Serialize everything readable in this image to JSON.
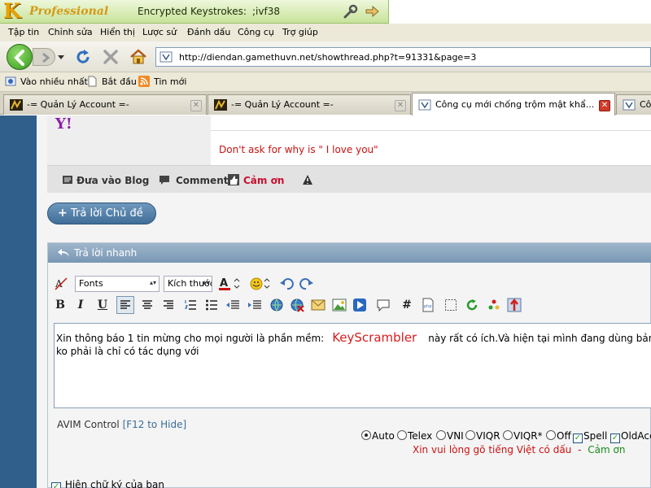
{
  "keyscrambler": {
    "logo_letter": "K",
    "edition": "Professional",
    "status_label": "Encrypted Keystrokes:",
    "keystrokes": ";ivf38"
  },
  "menu": [
    "Tập tin",
    "Chỉnh sửa",
    "Hiển thị",
    "Lược sử",
    "Đánh dấu",
    "Công cụ",
    "Trợ giúp"
  ],
  "navigation": {
    "url": "http://diendan.gamethuvn.net/showthread.php?t=91331&page=3"
  },
  "bookmarks": [
    "Vào nhiều nhất",
    "Bắt đầu",
    "Tin mới"
  ],
  "tabs": [
    {
      "label": "-= Quản Lý Account =-",
      "active": false
    },
    {
      "label": "-= Quản Lý Account =-",
      "active": false
    },
    {
      "label": "Công cụ mới chống trộm mật khẩ...",
      "active": true
    },
    {
      "label": "Côn",
      "active": false
    }
  ],
  "post": {
    "signature": "Don't ask for why is \" I love you\"",
    "actions": {
      "blog": "Đưa vào Blog",
      "comment": "Comment",
      "thanks": "Cảm ơn"
    }
  },
  "reply_button": "Trả lời Chủ đề",
  "quick_reply": {
    "title": "Trả lời nhanh",
    "font_select": "Fonts",
    "size_select": "Kích thước",
    "editor_before": "Xin thông báo 1 tin mừng cho mọi người là phần mềm:",
    "editor_highlight": "KeyScrambler",
    "editor_after": "này rất có ích.Và hiện tại mình đang dùng bản full c",
    "editor_line2": "ko phải là chỉ có tác dụng với",
    "avim_label": "AVIM Control",
    "avim_hide": "[F12 to Hide]",
    "avim_options": [
      "Auto",
      "Telex",
      "VNI",
      "VIQR",
      "VIQR*",
      "Off",
      "Spell",
      "OldAcc"
    ],
    "avim_selected": "Auto",
    "avim_message": "Xin vui lòng gõ tiếng Việt có dấu",
    "avim_separator": "-",
    "avim_thanks": "Cảm ơn",
    "show_signature": "Hiện chữ ký của bạn"
  },
  "colors": {
    "ks_banner": "#c8e39a",
    "rail": "#2f5f8a",
    "accent_blue": "#3f6e98",
    "signature_red": "#cc1111"
  }
}
